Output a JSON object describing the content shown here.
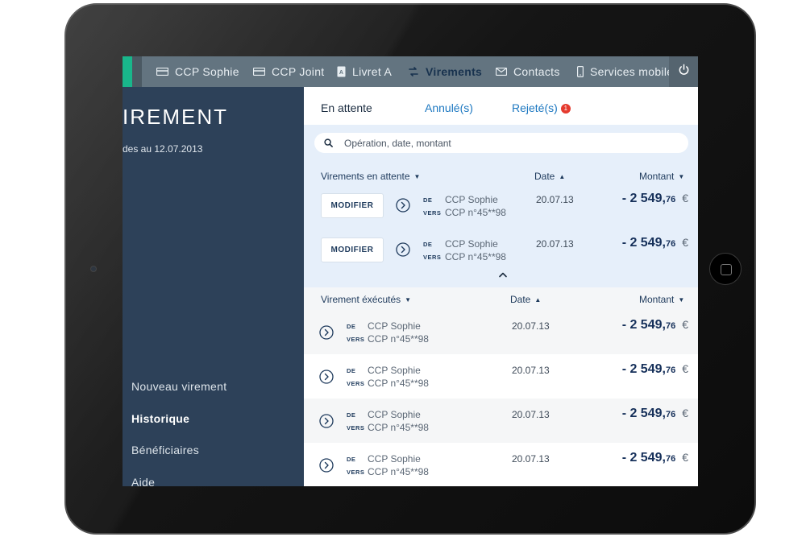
{
  "nav": {
    "items": [
      {
        "label": "CCP Sophie",
        "icon": "card-icon"
      },
      {
        "label": "CCP Joint",
        "icon": "card-icon"
      },
      {
        "label": "Livret A",
        "icon": "booklet-icon"
      },
      {
        "label": "Virements",
        "icon": "transfer-icon",
        "active": true
      },
      {
        "label": "Contacts",
        "icon": "mail-icon"
      },
      {
        "label": "Services mobile",
        "icon": "phone-icon"
      }
    ],
    "power_icon": "power-icon"
  },
  "left": {
    "title": "IREMENT",
    "subtitle": "des au 12.07.2013",
    "links": [
      {
        "label": "Nouveau virement"
      },
      {
        "label": "Historique",
        "active": true
      },
      {
        "label": "Bénéficiaires"
      },
      {
        "label": "Aide"
      }
    ]
  },
  "tabs": [
    {
      "label": "En attente",
      "active": true
    },
    {
      "label": "Annulé(s)"
    },
    {
      "label": "Rejeté(s)",
      "badge": "1"
    }
  ],
  "search": {
    "placeholder": "Opération, date, montant"
  },
  "pending": {
    "header": {
      "title": "Virements en attente",
      "date": "Date",
      "amount": "Montant"
    },
    "button_label": "MODIFIER",
    "rows": [
      {
        "de": "DE",
        "vers": "VERS",
        "from": "CCP Sophie",
        "to": "CCP n°45**98",
        "date": "20.07.13",
        "amount_main": "- 2 549,",
        "amount_cents": "76",
        "currency": "€"
      },
      {
        "de": "DE",
        "vers": "VERS",
        "from": "CCP Sophie",
        "to": "CCP n°45**98",
        "date": "20.07.13",
        "amount_main": "- 2 549,",
        "amount_cents": "76",
        "currency": "€"
      }
    ]
  },
  "executed": {
    "header": {
      "title": "Virement éxécutés",
      "date": "Date",
      "amount": "Montant"
    },
    "rows": [
      {
        "de": "DE",
        "vers": "VERS",
        "from": "CCP Sophie",
        "to": "CCP n°45**98",
        "date": "20.07.13",
        "amount_main": "- 2 549,",
        "amount_cents": "76",
        "currency": "€"
      },
      {
        "de": "DE",
        "vers": "VERS",
        "from": "CCP Sophie",
        "to": "CCP n°45**98",
        "date": "20.07.13",
        "amount_main": "- 2 549,",
        "amount_cents": "76",
        "currency": "€"
      },
      {
        "de": "DE",
        "vers": "VERS",
        "from": "CCP Sophie",
        "to": "CCP n°45**98",
        "date": "20.07.13",
        "amount_main": "- 2 549,",
        "amount_cents": "76",
        "currency": "€"
      },
      {
        "de": "DE",
        "vers": "VERS",
        "from": "CCP Sophie",
        "to": "CCP n°45**98",
        "date": "20.07.13",
        "amount_main": "- 2 549,",
        "amount_cents": "76",
        "currency": "€"
      }
    ]
  },
  "colors": {
    "accent": "#19b68b",
    "nav_bg": "#637480",
    "sidebar_bg": "#2d4159",
    "pending_bg": "#e6effa",
    "amount": "#16305a",
    "link": "#1d78c1",
    "badge": "#e53a2e"
  }
}
